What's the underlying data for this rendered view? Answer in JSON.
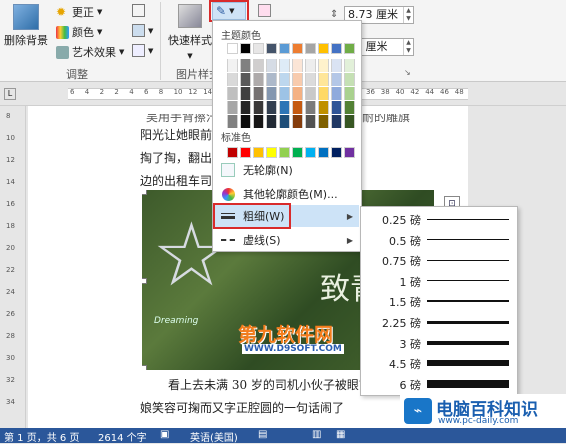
{
  "ribbon": {
    "remove_bg": "删除背景",
    "corrections": "更正",
    "color": "颜色",
    "artistic": "艺术效果",
    "adjust_group": "调整",
    "quick_styles": "快速样式",
    "picture_styles_group": "图片样式",
    "height_value": "8.73 厘米",
    "width_value": "65 厘米"
  },
  "menu": {
    "theme_colors_label": "主题颜色",
    "standard_colors_label": "标准色",
    "no_outline": "无轮廓(N)",
    "more_colors": "其他轮廓颜色(M)...",
    "weight": "粗细(W)",
    "dashes": "虚线(S)"
  },
  "theme_colors": {
    "top_row": [
      "#ffffff",
      "#000000",
      "#e7e6e6",
      "#44546a",
      "#5b9bd5",
      "#ed7d31",
      "#a5a5a5",
      "#ffc000",
      "#4472c4",
      "#70ad47"
    ],
    "columns": [
      [
        "#f2f2f2",
        "#d9d9d9",
        "#bfbfbf",
        "#a6a6a6",
        "#808080"
      ],
      [
        "#808080",
        "#595959",
        "#404040",
        "#262626",
        "#0d0d0d"
      ],
      [
        "#d0cece",
        "#aeaaaa",
        "#757171",
        "#3a3838",
        "#171616"
      ],
      [
        "#d6dce5",
        "#adb9ca",
        "#8497b0",
        "#333f50",
        "#222a35"
      ],
      [
        "#deebf7",
        "#bdd7ee",
        "#9dc3e6",
        "#2e75b6",
        "#1f4e79"
      ],
      [
        "#fbe5d6",
        "#f8cbad",
        "#f4b183",
        "#c55a11",
        "#843c0c"
      ],
      [
        "#ededed",
        "#dbdbdb",
        "#c9c9c9",
        "#7b7b7b",
        "#525252"
      ],
      [
        "#fff2cc",
        "#ffe699",
        "#ffd966",
        "#bf9000",
        "#7f6000"
      ],
      [
        "#dae3f3",
        "#b4c7e7",
        "#8faadc",
        "#2f5597",
        "#203864"
      ],
      [
        "#e2f0d9",
        "#c5e0b4",
        "#a9d18e",
        "#538135",
        "#375623"
      ]
    ],
    "standard": [
      "#c00000",
      "#ff0000",
      "#ffc000",
      "#ffff00",
      "#92d050",
      "#00b050",
      "#00b0f0",
      "#0070c0",
      "#002060",
      "#7030a0"
    ]
  },
  "weights": [
    {
      "label": "0.25 磅",
      "pt": 0.25
    },
    {
      "label": "0.5 磅",
      "pt": 0.5
    },
    {
      "label": "0.75 磅",
      "pt": 0.75
    },
    {
      "label": "1 磅",
      "pt": 1
    },
    {
      "label": "1.5 磅",
      "pt": 1.5
    },
    {
      "label": "2.25 磅",
      "pt": 2.25
    },
    {
      "label": "3 磅",
      "pt": 3
    },
    {
      "label": "4.5 磅",
      "pt": 4.5
    },
    {
      "label": "6 磅",
      "pt": 6
    }
  ],
  "document": {
    "line1": "阳光让她眼前一亮，                                  口袋里",
    "line2": "掏了掏，翻出                                  零钱，递给身",
    "line3": "边的出租车司                                  啊，叔叔。”",
    "line4": "看上去未满 30 岁的司机小伙子被眼前",
    "line5": "娘笑容可掬而又字正腔圆的一句话闹了",
    "photo_text_1": "致青",
    "photo_text_2": "Dreaming"
  },
  "watermark": {
    "brand": "第九软件网",
    "url": "WWW.D9SOFT.COM",
    "site_name": "电脑百科知识",
    "site_url": "www.pc-daily.com"
  },
  "status": {
    "page": "第 1 页，共 6 页",
    "words": "2614 个字",
    "lang": "英语(美国)"
  },
  "ruler_numbers": [
    "6",
    "4",
    "2",
    "2",
    "4",
    "6",
    "8",
    "10",
    "12",
    "14",
    "16",
    "18",
    "20",
    "22",
    "24",
    "26",
    "28",
    "30",
    "32",
    "34",
    "36",
    "38",
    "40",
    "42",
    "44",
    "46",
    "48"
  ],
  "vruler_numbers": [
    "8",
    "10",
    "12",
    "14",
    "16",
    "18",
    "20",
    "22",
    "24",
    "26",
    "28",
    "30",
    "32",
    "34"
  ]
}
